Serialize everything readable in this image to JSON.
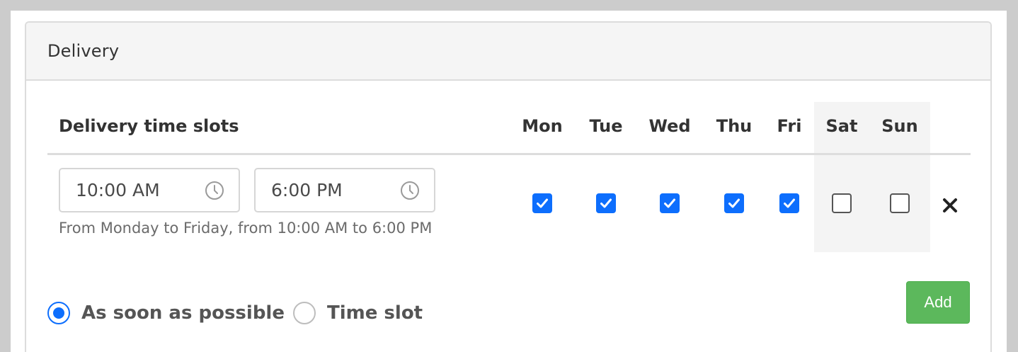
{
  "panel": {
    "title": "Delivery"
  },
  "table": {
    "title": "Delivery time slots",
    "days": [
      "Mon",
      "Tue",
      "Wed",
      "Thu",
      "Fri",
      "Sat",
      "Sun"
    ]
  },
  "slot": {
    "start_time": "10:00 AM",
    "end_time": "6:00 PM",
    "help_text": "From Monday to Friday, from 10:00 AM to 6:00 PM",
    "days_checked": [
      true,
      true,
      true,
      true,
      true,
      false,
      false
    ]
  },
  "delivery_mode": {
    "options": [
      {
        "label": "As soon as possible",
        "selected": true
      },
      {
        "label": "Time slot",
        "selected": false
      }
    ]
  },
  "buttons": {
    "add_label": "Add"
  },
  "colors": {
    "accent": "#0d6efd",
    "add_button": "#5cb85c",
    "header_bg": "#f5f5f5",
    "weekend_bg": "#f4f4f4"
  },
  "icons": {
    "time_input": "clock-icon",
    "remove": "close-icon"
  }
}
